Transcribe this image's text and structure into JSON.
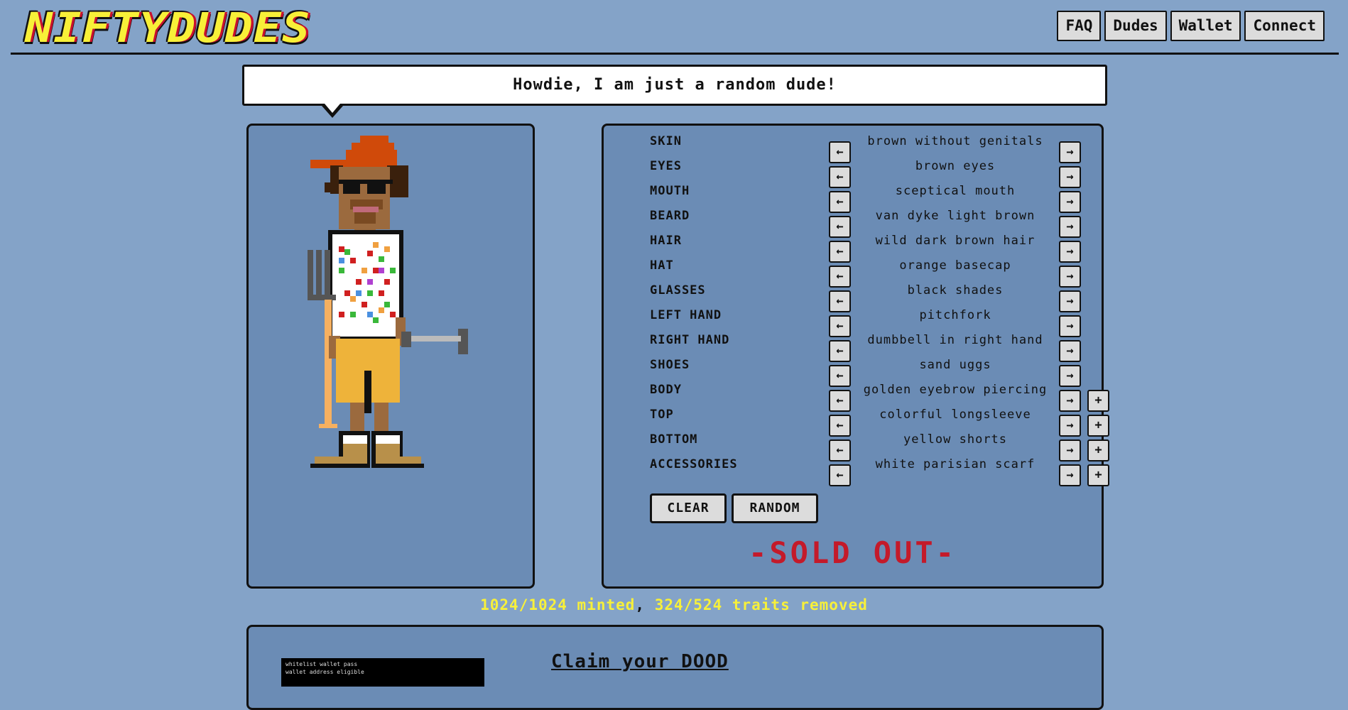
{
  "header": {
    "logo_text": "NIFTYDUDES",
    "nav": [
      "FAQ",
      "Dudes",
      "Wallet",
      "Connect"
    ]
  },
  "bubble": {
    "text": "Howdie, I am just a random dude!"
  },
  "traits": [
    {
      "label": "SKIN",
      "value": "brown without genitals",
      "plus": false
    },
    {
      "label": "EYES",
      "value": "brown eyes",
      "plus": false
    },
    {
      "label": "MOUTH",
      "value": "sceptical mouth",
      "plus": false
    },
    {
      "label": "BEARD",
      "value": "van dyke light brown",
      "plus": false
    },
    {
      "label": "HAIR",
      "value": "wild dark brown hair",
      "plus": false
    },
    {
      "label": "HAT",
      "value": "orange basecap",
      "plus": false
    },
    {
      "label": "GLASSES",
      "value": "black shades",
      "plus": false
    },
    {
      "label": "LEFT HAND",
      "value": "pitchfork",
      "plus": false
    },
    {
      "label": "RIGHT HAND",
      "value": "dumbbell in right hand",
      "plus": false
    },
    {
      "label": "SHOES",
      "value": "sand uggs",
      "plus": false
    },
    {
      "label": "BODY",
      "value": "golden eyebrow piercing",
      "plus": true
    },
    {
      "label": "TOP",
      "value": "colorful longsleeve",
      "plus": true
    },
    {
      "label": "BOTTOM",
      "value": "yellow shorts",
      "plus": true
    },
    {
      "label": "ACCESSORIES",
      "value": "white parisian scarf",
      "plus": true
    }
  ],
  "buttons": {
    "arrow_left": "←",
    "arrow_right": "→",
    "plus": "+",
    "clear": "CLEAR",
    "random": "RANDOM"
  },
  "sold_out": "-SOLD OUT-",
  "stats": {
    "minted": "1024/1024 minted",
    "separator": ", ",
    "traits_removed": "324/524 traits removed"
  },
  "claim": {
    "title": "Claim your DOOD",
    "thumb_lines": [
      "whitelist wallet pass",
      "wallet address eligible"
    ]
  },
  "colors": {
    "background": "#84a3c8",
    "panel": "#6b8cb5",
    "accent_yellow": "#f7f03a",
    "sold_out_red": "#c41a2a"
  }
}
